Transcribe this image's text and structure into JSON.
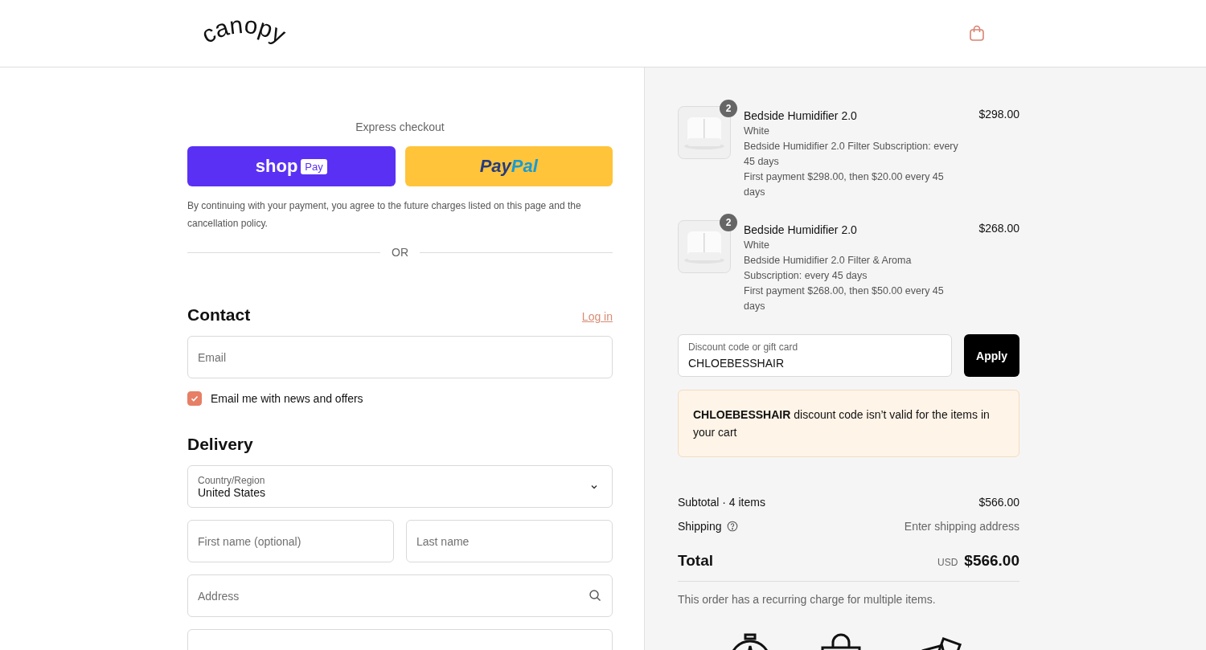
{
  "header": {
    "logo": "canopy"
  },
  "express": {
    "title": "Express checkout",
    "shop_pay": {
      "word": "shop",
      "tag": "Pay"
    },
    "paypal": [
      "Pay",
      "Pal"
    ],
    "notice": "By continuing with your payment, you agree to the future charges listed on this page and the cancellation policy.",
    "divider": "OR"
  },
  "contact": {
    "heading": "Contact",
    "login": "Log in",
    "email": {
      "placeholder": "Email"
    },
    "newsletter": {
      "label": "Email me with news and offers",
      "checked": true
    }
  },
  "delivery": {
    "heading": "Delivery",
    "country": {
      "label": "Country/Region",
      "value": "United States"
    },
    "first_name": {
      "placeholder": "First name (optional)"
    },
    "last_name": {
      "placeholder": "Last name"
    },
    "address": {
      "placeholder": "Address"
    }
  },
  "items": [
    {
      "quantity": "2",
      "name": "Bedside Humidifier 2.0",
      "price": "$298.00",
      "details": [
        "White",
        "Bedside Humidifier 2.0 Filter Subscription: every 45 days",
        "First payment $298.00, then $20.00 every 45 days"
      ]
    },
    {
      "quantity": "2",
      "name": "Bedside Humidifier 2.0",
      "price": "$268.00",
      "details": [
        "White",
        "Bedside Humidifier 2.0 Filter & Aroma Subscription: every 45 days",
        "First payment $268.00, then $50.00 every 45 days"
      ]
    }
  ],
  "discount": {
    "label": "Discount code or gift card",
    "value": "CHLOEBESSHAIR",
    "button": "Apply",
    "error": "**CHLOEBESSHAIR** discount code isn’t valid for the items in your cart"
  },
  "summary": {
    "subtotal_label": "Subtotal · 4 items",
    "subtotal": "$566.00",
    "shipping_label": "Shipping",
    "shipping": "Enter shipping address",
    "total_label": "Total",
    "currency": "USD",
    "total": "$566.00",
    "recurring_note": "This order has a recurring charge for multiple items."
  }
}
